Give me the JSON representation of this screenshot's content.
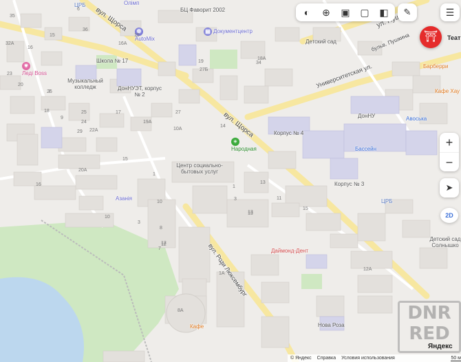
{
  "streets": {
    "shchorsa_top": "вул. Щорса",
    "shchorsa_mid": "вул. Щорса",
    "pushkina_top": "ул. Пушкина",
    "pushkina_blvd": "бульв. Пушкина",
    "universitetskaya": "Университетская ул.",
    "rozy_lyuksemburg": "вул. Рози Люксембург"
  },
  "pois": {
    "olimp": "Олімп",
    "tsrb_top": "ЦРБ",
    "bc_favorit": "БЦ Фаворит 2002",
    "dokumenttsentr": "Документцентр",
    "automix": "AutoMix",
    "detsky_sad_top": "Детский сад",
    "teatr": "Теат",
    "barberry": "Барберри",
    "kafe_khau": "Кафе Хау",
    "ledi_bos": "Леді Boss",
    "shkola_17": "Школа № 17",
    "muz_college": "Музыкальный колледж",
    "donnuet_2": "ДонНУЭТ, корпус № 2",
    "donnu": "ДонНУ",
    "aviosha": "Авоська",
    "korpus_4": "Корпус № 4",
    "narodnaya": "Народная",
    "bassein": "Бассейн",
    "center_social": "Центр социально-бытовых услуг",
    "korpus_3": "Корпус № 3",
    "azaniya": "Азанія",
    "tsrb_right": "ЦРБ",
    "detsky_sad_solnyshko": "Детский сад Солнышко",
    "daymond_dent": "Даймонд-Дент",
    "kafe_bottom": "Кафе",
    "nova_roza": "Нова Роза"
  },
  "house_numbers": [
    "15",
    "19",
    "16А",
    "10А",
    "15",
    "36",
    "7",
    "9",
    "23",
    "34",
    "27Б",
    "18А",
    "29",
    "19А",
    "17",
    "25",
    "10",
    "16",
    "27",
    "24",
    "22А",
    "18",
    "13",
    "14",
    "20А",
    "15",
    "20",
    "32А",
    "35",
    "26",
    "16",
    "6",
    "7",
    "8",
    "12",
    "10",
    "1",
    "3",
    "15",
    "13",
    "11",
    "1",
    "3",
    "12А",
    "13",
    "12",
    "8А",
    "1А",
    "2"
  ],
  "toolbar": {
    "layers_icon": "layers-icon",
    "panorama_icon": "panorama-icon",
    "camera_icon": "camera-icon",
    "transport_icon": "bus-icon",
    "traffic_icon": "traffic-icon",
    "ruler_icon": "ruler-icon",
    "menu_icon": "menu-icon"
  },
  "controls": {
    "zoom_in": "+",
    "zoom_out": "−",
    "locate_icon": "locate-arrow-icon",
    "mode_2d": "2D"
  },
  "footer": {
    "copyright": "© Яндекс",
    "help": "Справка",
    "terms": "Условия использования",
    "scale": "50 м"
  },
  "watermark": {
    "line1": "DNR",
    "line2": "RED",
    "brand": "Яндекс"
  },
  "colors": {
    "road_yellow": "#f7e7a0",
    "park_green": "#cfe8c2",
    "water_blue": "#bcd7ee",
    "building": "#e3e0dc",
    "university": "#d4d4ea",
    "accent_red": "#e52b2b"
  }
}
